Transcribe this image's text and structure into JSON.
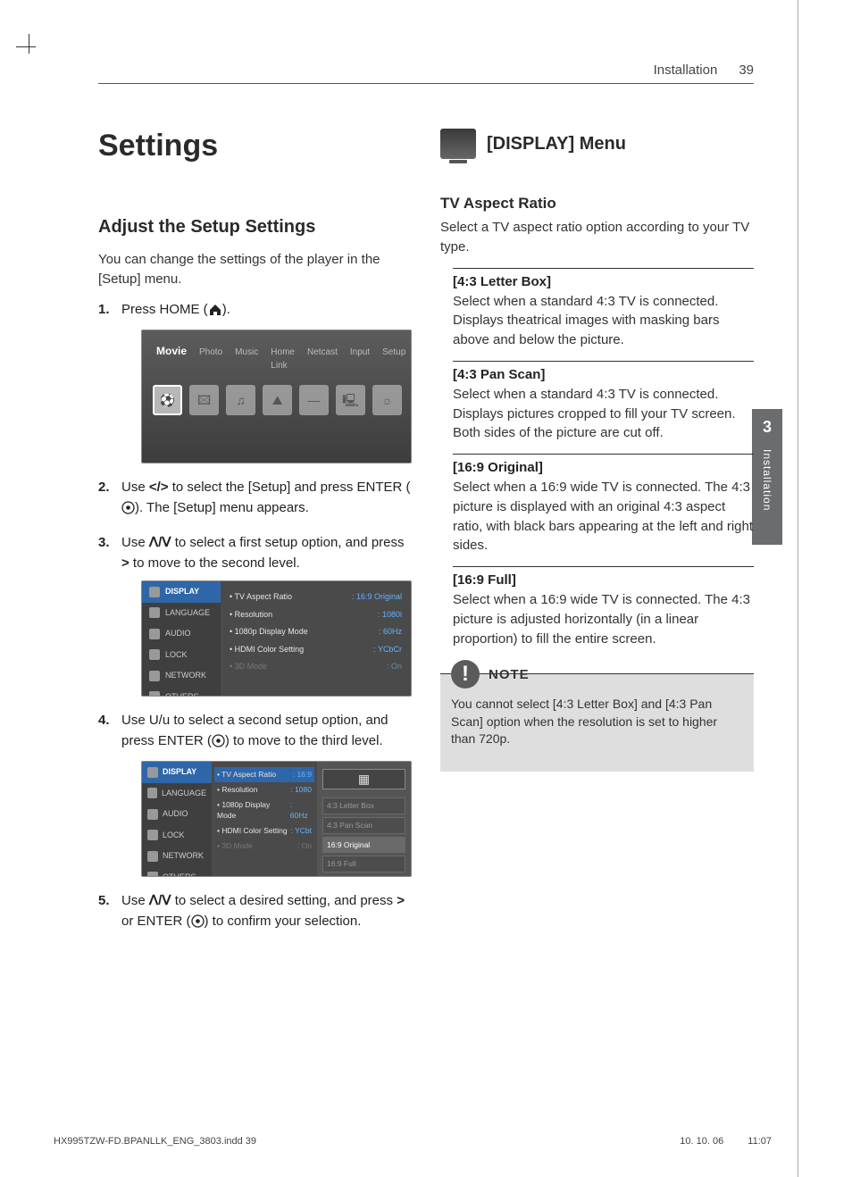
{
  "header": {
    "section": "Installation",
    "page": "39"
  },
  "side_tab": {
    "num": "3",
    "label": "Installation"
  },
  "h1": "Settings",
  "left": {
    "h2": "Adjust the Setup Settings",
    "intro": "You can change the settings of the player in the [Setup] menu.",
    "step1_a": "Press HOME (",
    "step1_b": ").",
    "shot1": {
      "tabs": [
        "Movie",
        "Photo",
        "Music",
        "Home Link",
        "Netcast",
        "Input",
        "Setup"
      ],
      "icons": [
        "⚽",
        "🖾",
        "♫",
        "⛰",
        "—",
        "🖳",
        "☼"
      ]
    },
    "step2_a": "Use ",
    "step2_b": " to select the [Setup] and press ENTER (",
    "step2_c": "). The [Setup] menu appears.",
    "step3_a": "Use ",
    "step3_b": " to select a first setup option, and press ",
    "step3_c": " to move to the second level.",
    "shot2": {
      "side": [
        "DISPLAY",
        "LANGUAGE",
        "AUDIO",
        "LOCK",
        "NETWORK",
        "OTHERS"
      ],
      "opts": [
        {
          "k": "• TV Aspect Ratio",
          "v": ": 16:9 Original"
        },
        {
          "k": "• Resolution",
          "v": ": 1080i"
        },
        {
          "k": "• 1080p Display Mode",
          "v": ": 60Hz"
        },
        {
          "k": "• HDMI Color Setting",
          "v": ": YCbCr"
        },
        {
          "k": "• 3D Mode",
          "v": ": On",
          "dim": true
        }
      ]
    },
    "step4_a": "Use U/u to select a second setup option, and press ENTER (",
    "step4_b": ") to move to the third level.",
    "shot3": {
      "side": [
        "DISPLAY",
        "LANGUAGE",
        "AUDIO",
        "LOCK",
        "NETWORK",
        "OTHERS"
      ],
      "opts": [
        {
          "k": "• TV Aspect Ratio",
          "v": ": 16:9",
          "hl": true
        },
        {
          "k": "• Resolution",
          "v": ": 1080"
        },
        {
          "k": "• 1080p Display Mode",
          "v": ": 60Hz"
        },
        {
          "k": "• HDMI Color Setting",
          "v": ": YCbt"
        },
        {
          "k": "• 3D Mode",
          "v": ": On",
          "dim": true
        }
      ],
      "popup": [
        "4:3 Letter Box",
        "4:3 Pan Scan",
        "16:9 Original",
        "16:9 Full"
      ],
      "popup_selected": 2
    },
    "step5_a": "Use ",
    "step5_b": " to select a desired setting, and press ",
    "step5_c": " or ENTER (",
    "step5_d": ") to confirm your selection."
  },
  "right": {
    "display_menu": "[DISPLAY] Menu",
    "h3": "TV Aspect Ratio",
    "intro": "Select a TV aspect ratio option according to your TV type.",
    "opts": [
      {
        "label": "[4:3 Letter Box]",
        "desc": "Select when a standard 4:3 TV is connected. Displays theatrical images with masking bars above and below the picture."
      },
      {
        "label": "[4:3 Pan Scan]",
        "desc": "Select when a standard 4:3 TV is connected. Displays pictures cropped to fill your TV screen. Both sides of the picture are cut off."
      },
      {
        "label": "[16:9 Original]",
        "desc": "Select when a 16:9 wide TV is connected. The 4:3 picture is displayed with an original 4:3 aspect ratio, with black bars appearing at the left and right sides."
      },
      {
        "label": "[16:9 Full]",
        "desc": "Select when a 16:9 wide TV is connected. The 4:3 picture is adjusted horizontally (in a linear proportion) to fill the entire screen."
      }
    ],
    "note_label": "NOTE",
    "note_body": "You cannot select [4:3 Letter Box] and [4:3 Pan Scan] option when the resolution is set to higher than 720p."
  },
  "footer": {
    "left": "HX995TZW-FD.BPANLLK_ENG_3803.indd   39",
    "date": "10. 10. 06",
    "time": "11:07"
  },
  "arrows": {
    "lr": "</>",
    "ud": "ᐱ/ᐯ",
    "right": ">"
  }
}
